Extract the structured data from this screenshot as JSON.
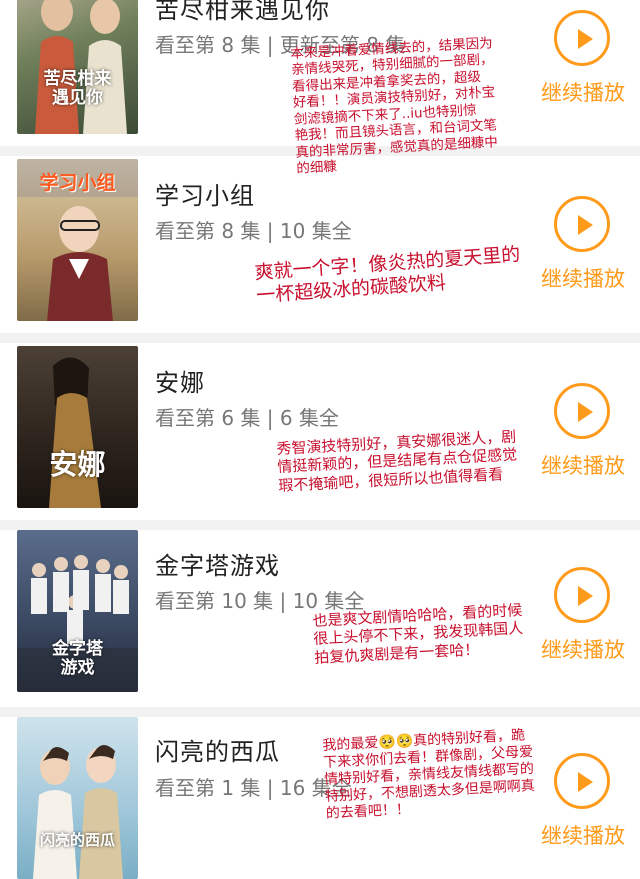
{
  "shows": [
    {
      "title": "苦尽柑来遇见你",
      "progress": "看至第 8 集 | 更新至第 8 集",
      "poster_text": "苦尽柑来\n遇见你",
      "continue_label": "继续播放",
      "play_icon": "play-icon",
      "note": "本来是冲着爱情线去的，结果因为\n亲情线哭死，特别细腻的一部剧，\n看得出来是冲着拿奖去的，超级\n好看！！演员演技特别好，对朴宝\n剑滤镜摘不下来了..iu也特别惊\n艳我！而且镜头语言，和台词文笔\n真的非常厉害，感觉真的是细糠中\n的细糠"
    },
    {
      "title": "学习小组",
      "progress": "看至第 8 集 | 10 集全",
      "poster_text": "学习小组",
      "continue_label": "继续播放",
      "play_icon": "play-icon",
      "note": "爽就一个字！像炎热的夏天里的\n一杯超级冰的碳酸饮料"
    },
    {
      "title": "安娜",
      "progress": "看至第 6 集 | 6 集全",
      "poster_text": "安娜",
      "continue_label": "继续播放",
      "play_icon": "play-icon",
      "note": "秀智演技特别好，真安娜很迷人，剧\n情挺新颖的，但是结尾有点仓促感觉\n瑕不掩瑜吧，很短所以也值得看看"
    },
    {
      "title": "金字塔游戏",
      "progress": "看至第 10 集 | 10 集全",
      "poster_text": "金字塔\n游戏",
      "continue_label": "继续播放",
      "play_icon": "play-icon",
      "note": "也是爽文剧情哈哈哈，看的时候\n很上头停不下来，我发现韩国人\n拍复仇爽剧是有一套哈！"
    },
    {
      "title": "闪亮的西瓜",
      "progress": "看至第 1 集 | 16 集全",
      "poster_text": "闪亮的西瓜",
      "continue_label": "继续播放",
      "play_icon": "play-icon",
      "note": "我的最爱🥺🥺真的特别好看，跪\n下来求你们去看！群像剧，父母爱\n情特别好看，亲情线友情线都写的\n特别好，不想剧透太多但是啊啊真\n的去看吧！！"
    }
  ],
  "colors": {
    "accent": "#ff9a1a",
    "note": "#c8102e",
    "title": "#222222",
    "progress": "#777777",
    "divider": "#f2f2f2"
  }
}
